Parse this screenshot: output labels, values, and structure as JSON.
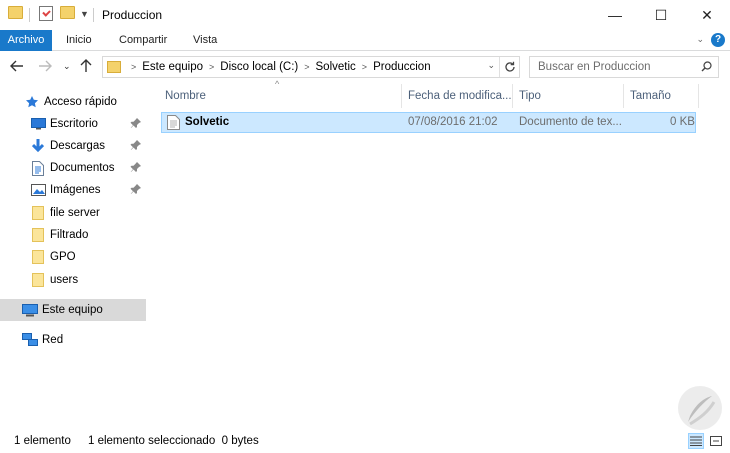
{
  "window": {
    "title": "Produccion",
    "minimize_glyph": "—",
    "maximize_glyph": "☐",
    "close_glyph": "✕"
  },
  "ribbon": {
    "tabs": [
      {
        "label": "Archivo"
      },
      {
        "label": "Inicio"
      },
      {
        "label": "Compartir"
      },
      {
        "label": "Vista"
      }
    ],
    "help": "?"
  },
  "address": {
    "crumbs": [
      "Este equipo",
      "Disco local (C:)",
      "Solvetic",
      "Produccion"
    ]
  },
  "search": {
    "placeholder": "Buscar en Produccion"
  },
  "sidebar": {
    "quick_access": "Acceso rápido",
    "items": [
      {
        "label": "Escritorio",
        "icon": "desktop-icon",
        "pinned": true
      },
      {
        "label": "Descargas",
        "icon": "download-icon",
        "pinned": true
      },
      {
        "label": "Documentos",
        "icon": "documents-icon",
        "pinned": true
      },
      {
        "label": "Imágenes",
        "icon": "pictures-icon",
        "pinned": true
      },
      {
        "label": "file server",
        "icon": "folder-icon",
        "pinned": false
      },
      {
        "label": "Filtrado",
        "icon": "folder-icon",
        "pinned": false
      },
      {
        "label": "GPO",
        "icon": "folder-icon",
        "pinned": false
      },
      {
        "label": "users",
        "icon": "folder-icon",
        "pinned": false
      }
    ],
    "this_pc": "Este equipo",
    "network": "Red"
  },
  "columns": [
    "Nombre",
    "Fecha de modifica...",
    "Tipo",
    "Tamaño"
  ],
  "files": [
    {
      "name": "Solvetic",
      "modified": "07/08/2016 21:02",
      "type": "Documento de tex...",
      "size": "0 KB",
      "selected": true
    }
  ],
  "status": {
    "count": "1 elemento",
    "selection": "1 elemento seleccionado  0 bytes"
  },
  "colors": {
    "accent": "#1979ca",
    "selection_bg": "#cce8ff",
    "selection_border": "#99d1ff",
    "header_text": "#4c607a"
  }
}
